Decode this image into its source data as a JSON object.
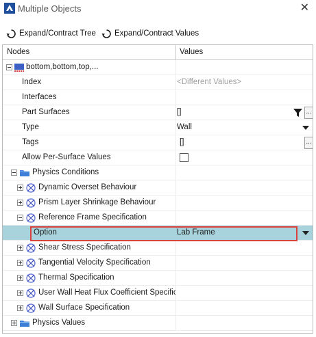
{
  "window": {
    "title": "Multiple Objects",
    "close": "✕"
  },
  "toolbar": {
    "expand_tree": "Expand/Contract Tree",
    "expand_values": "Expand/Contract Values"
  },
  "columns": {
    "nodes": "Nodes",
    "values": "Values"
  },
  "rows": {
    "root": {
      "label": "bottom,bottom,top,..."
    },
    "index": {
      "label": "Index",
      "value": "<Different Values>"
    },
    "interfaces": {
      "label": "Interfaces"
    },
    "part_surfaces": {
      "label": "Part Surfaces",
      "value": "[]"
    },
    "type": {
      "label": "Type",
      "value": "Wall"
    },
    "tags": {
      "label": "Tags",
      "value": "[]"
    },
    "per_surface": {
      "label": "Allow Per-Surface Values"
    },
    "physics_conditions": {
      "label": "Physics Conditions"
    },
    "dynamic_overset": {
      "label": "Dynamic Overset Behaviour"
    },
    "prism_layer": {
      "label": "Prism Layer Shrinkage Behaviour"
    },
    "ref_frame": {
      "label": "Reference Frame Specification"
    },
    "option": {
      "label": "Option",
      "value": "Lab Frame"
    },
    "shear_stress": {
      "label": "Shear Stress Specification"
    },
    "tangential_velocity": {
      "label": "Tangential Velocity Specification"
    },
    "thermal": {
      "label": "Thermal Specification"
    },
    "user_wall_heat": {
      "label": "User Wall Heat Flux Coefficient Specific"
    },
    "wall_surface": {
      "label": "Wall Surface Specification"
    },
    "physics_values": {
      "label": "Physics Values"
    }
  },
  "ellipsis_label": "...",
  "colors": {
    "selected_row": "#a8d3dd",
    "highlight": "#d8423a",
    "folder": "#3d7fd6"
  },
  "icons": {
    "app": "app-logo-icon",
    "tree_toggle": "expand-contract-icon",
    "region": "boundary-icon",
    "folder": "folder-icon",
    "condition": "condition-node-icon",
    "filter": "filter-icon"
  }
}
